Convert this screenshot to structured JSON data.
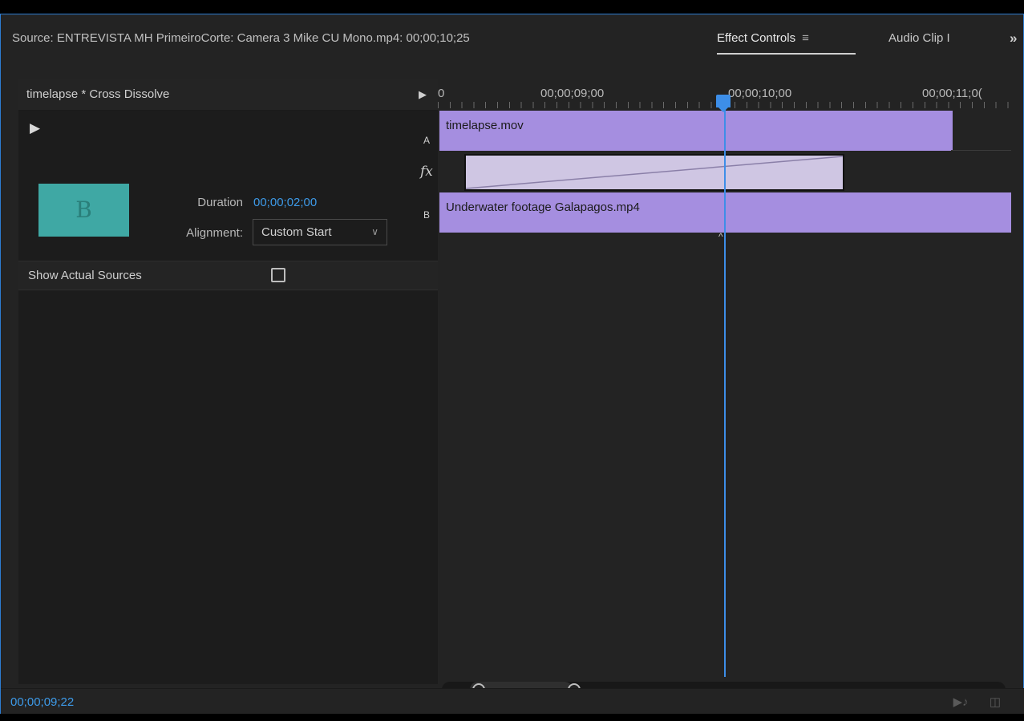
{
  "tabs": {
    "source": "Source: ENTREVISTA MH PrimeiroCorte: Camera 3 Mike CU Mono.mp4: 00;00;10;25",
    "effect_controls": "Effect Controls",
    "audio_clip": "Audio Clip I",
    "more": "»",
    "menu_icon": "≡"
  },
  "left": {
    "header": "timelapse * Cross Dissolve",
    "header_arrow": "▶",
    "play": "▶",
    "thumbnail_letter": "B",
    "duration_label": "Duration",
    "duration_value": "00;00;02;00",
    "alignment_label": "Alignment:",
    "alignment_value": "Custom Start",
    "show_actual_sources": "Show Actual Sources",
    "show_actual_sources_checked": false
  },
  "timeline": {
    "ruler": {
      "start": "0",
      "tc1": "00;00;09;00",
      "tc2": "00;00;10;00",
      "tc3": "00;00;11;0("
    },
    "track_a_label": "A",
    "fx_label": "fx",
    "track_b_label": "B",
    "clip_a": "timelapse.mov",
    "clip_b": "Underwater footage Galapagos.mp4"
  },
  "bottom": {
    "current_time": "00;00;09;22"
  },
  "colors": {
    "accent": "#3d8ee8",
    "clip": "#a58ee0",
    "transition": "#cfc6e3",
    "thumbnail": "#3fa8a4"
  }
}
